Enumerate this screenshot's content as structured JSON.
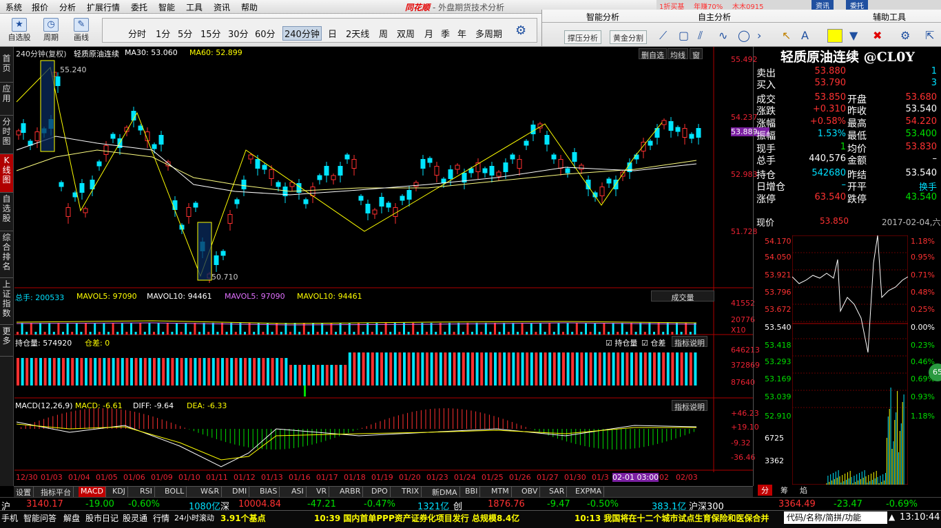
{
  "menu": [
    "系统",
    "报价",
    "分析",
    "扩展行情",
    "委托",
    "智能",
    "工具",
    "资讯",
    "帮助"
  ],
  "brand": {
    "logo": "同花顺",
    "title": "- 外盘期货技术分析"
  },
  "topright": {
    "promo": "1折买基",
    "rate": "年赚70%",
    "user": "木木0915",
    "news": "资讯",
    "entrust": "委托"
  },
  "toolbar": {
    "tools": [
      "自选股",
      "周期",
      "画线"
    ],
    "periods": [
      "分时",
      "1分",
      "5分",
      "15分",
      "30分",
      "60分",
      "240分钟",
      "日",
      "2天线",
      "周",
      "双周",
      "月",
      "季",
      "年",
      "多周期"
    ]
  },
  "panels": {
    "smart": "智能分析",
    "sub1": "撑压分析",
    "sub2": "黄金分割",
    "self": "自主分析",
    "assist": "辅助工具"
  },
  "leftbar": [
    "首页",
    "应用",
    "分时图",
    "K线图",
    "自选股",
    "综合排名",
    "上证指数",
    "更多"
  ],
  "chart": {
    "header": {
      "period": "240分钟(复权)",
      "name": "轻质原油连续",
      "ma30": "MA30: 53.060",
      "ma60": "MA60: 52.899"
    },
    "buttons": [
      "删自选",
      "均线",
      "窗"
    ],
    "yaxis": [
      "55.492",
      "54.237",
      "53.889",
      "52.983",
      "51.728"
    ],
    "high_label": "55.240",
    "low_label": "50.710",
    "vol": {
      "total": "总手: 200533",
      "mavol5": "MAVOL5: 97090",
      "mavol10": "MAVOL10: 94461",
      "mavol5b": "MAVOL5: 97090",
      "mavol10b": "MAVOL10: 94461",
      "btn": "成交量",
      "axis": [
        "41552",
        "20776",
        "X10"
      ]
    },
    "oi": {
      "label": "持仓量: 574920",
      "diff": "仓差: 0",
      "chk1": "持仓量",
      "chk2": "仓差",
      "btn": "指标说明",
      "axis": [
        "646213",
        "372869",
        "87640"
      ]
    },
    "macd": {
      "label": "MACD(12,26,9)",
      "macd": "MACD: -6.61",
      "diff": "DIFF: -9.64",
      "dea": "DEA: -6.33",
      "btn": "指标说明",
      "axis": [
        "+46.23",
        "+19.10",
        "-9.32",
        "-36.46"
      ]
    },
    "xaxis": [
      "12/30",
      "01/03",
      "01/04",
      "01/05",
      "01/06",
      "01/09",
      "01/10",
      "01/11",
      "01/12",
      "01/13",
      "01/16",
      "01/17",
      "01/18",
      "01/19",
      "01/20",
      "01/23",
      "01/24",
      "01/25",
      "01/26",
      "01/27",
      "01/30",
      "01/3",
      "02-01 03:00",
      "02",
      "02/03"
    ]
  },
  "tabs": [
    "设置",
    "指标平台",
    "MACD",
    "KDJ",
    "RSI",
    "BOLL",
    "W&R",
    "DMI",
    "BIAS",
    "ASI",
    "VR",
    "ARBR",
    "DPO",
    "TRIX",
    "新DMA",
    "BBI",
    "MTM",
    "OBV",
    "SAR",
    "EXPMA"
  ],
  "quote": {
    "title": "轻质原油连续 @CL0Y",
    "rows": [
      {
        "l": "卖出",
        "v": "53.880",
        "l2": "",
        "v2": "1"
      },
      {
        "l": "买入",
        "v": "53.790",
        "l2": "",
        "v2": "3"
      },
      {
        "l": "成交",
        "v": "53.850",
        "l2": "开盘",
        "v2": "53.680"
      },
      {
        "l": "涨跌",
        "v": "+0.310",
        "l2": "昨收",
        "v2": "53.540"
      },
      {
        "l": "涨幅",
        "v": "+0.58%",
        "l2": "最高",
        "v2": "54.220"
      },
      {
        "l": "振幅",
        "v": "1.53%",
        "l2": "最低",
        "v2": "53.400"
      },
      {
        "l": "现手",
        "v": "1",
        "l2": "均价",
        "v2": "53.830"
      },
      {
        "l": "总手",
        "v": "440,576",
        "l2": "金额",
        "v2": "–"
      },
      {
        "l": "持仓",
        "v": "542680",
        "l2": "昨结",
        "v2": "53.540"
      },
      {
        "l": "日增仓",
        "v": "–",
        "l2": "开平",
        "v2": "换手"
      },
      {
        "l": "涨停",
        "v": "63.540",
        "l2": "跌停",
        "v2": "43.540"
      }
    ],
    "price_label": "现价",
    "price": "53.850",
    "date": "2017-02-04,六",
    "mini_left": [
      "54.170",
      "54.050",
      "53.921",
      "53.796",
      "53.672",
      "53.540",
      "53.418",
      "53.293",
      "53.169",
      "53.039",
      "52.910",
      "6725",
      "3362"
    ],
    "mini_right": [
      "1.18%",
      "0.95%",
      "0.71%",
      "0.48%",
      "0.25%",
      "0.00%",
      "0.23%",
      "0.46%",
      "0.69%",
      "0.93%",
      "1.18%"
    ],
    "badge": "65",
    "tabs": [
      "分",
      "筹",
      "焰"
    ]
  },
  "ticker": {
    "sh": "沪",
    "sh_v": "3140.17",
    "sh_c": "-19.00",
    "sh_p": "-0.60%",
    "sh_a": "1080亿",
    "sz": "深",
    "sz_v": "10004.84",
    "sz_c": "-47.21",
    "sz_p": "-0.47%",
    "sz_a": "1321亿",
    "cy": "创",
    "cy_v": "1876.76",
    "cy_c": "-9.47",
    "cy_p": "-0.50%",
    "cy_a": "383.1亿",
    "hs": "沪深300",
    "hs_v": "3364.49",
    "hs_c": "-23.47",
    "hs_p": "-0.69%"
  },
  "status": {
    "items": [
      "手机",
      "智能问答",
      "解盘",
      "股市日记",
      "股灵通",
      "行情",
      "24小时滚动"
    ],
    "news0": "3.91个基点",
    "news1": "10:39 国内首单PPP资产证券化项目发行 总规模8.4亿",
    "news2": "10:13 我国将在十二个城市试点生育保险和医保合并",
    "search": "代码/名称/简拼/功能",
    "time": "13:10:44"
  }
}
